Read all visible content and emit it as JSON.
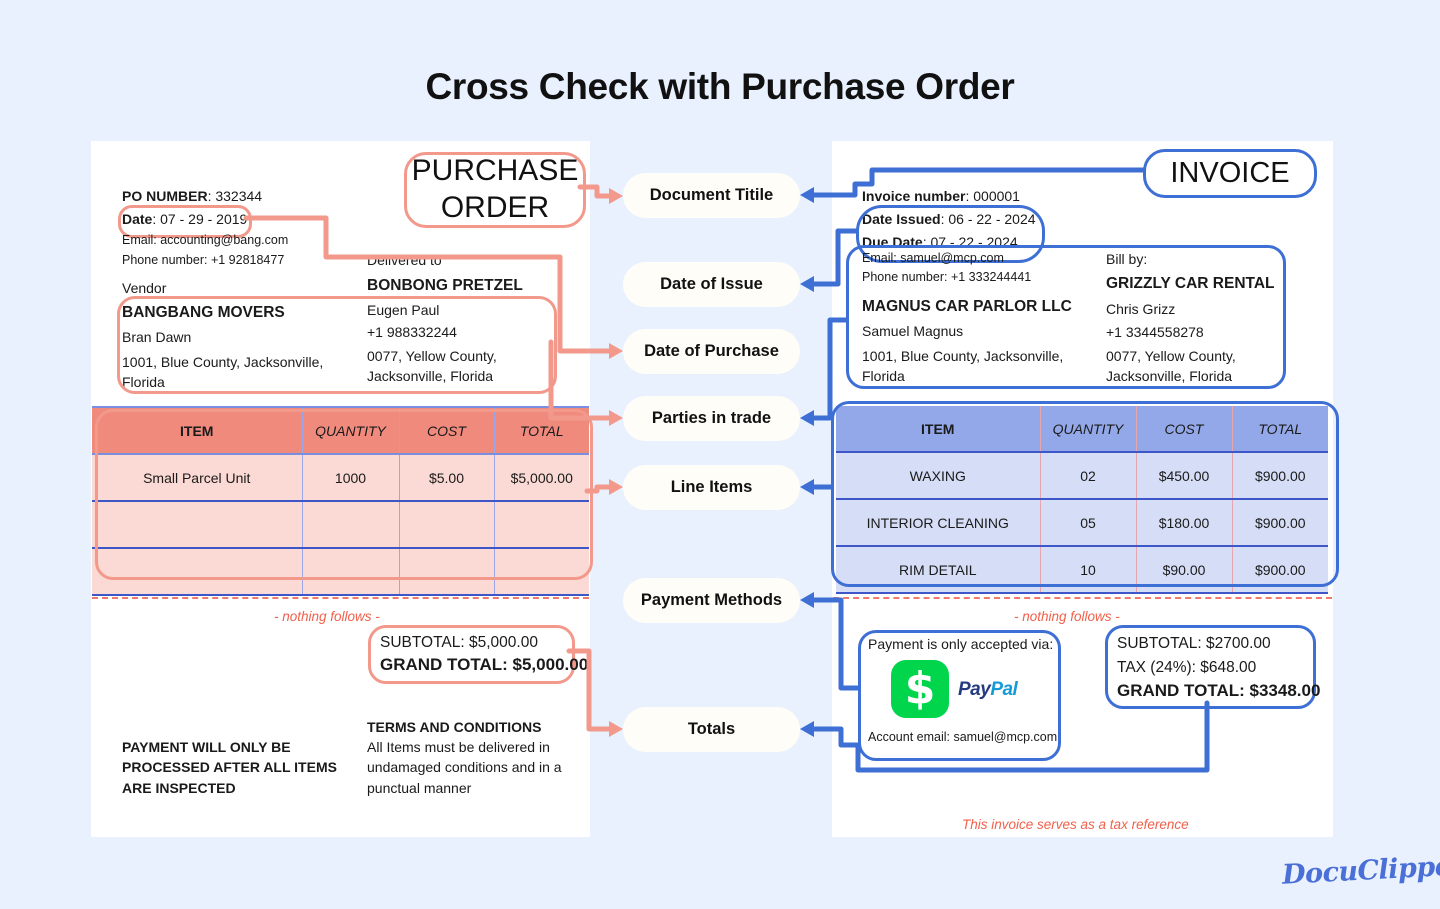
{
  "page": {
    "title": "Cross Check with Purchase Order",
    "background_color": "#e9f0fe",
    "brand_logo": "DocuClipper",
    "accent_pink": "#f2998c",
    "accent_blue": "#3e6fd4"
  },
  "labels": [
    {
      "text": "Document Titile"
    },
    {
      "text": "Date of Issue"
    },
    {
      "text": "Date of Purchase"
    },
    {
      "text": "Parties in trade"
    },
    {
      "text": "Line Items"
    },
    {
      "text": "Payment Methods"
    },
    {
      "text": "Totals"
    }
  ],
  "purchase_order": {
    "doc_type": "PURCHASE ORDER",
    "po_number_label": "PO NUMBER",
    "po_number_value": ": 332344",
    "date_label": "Date",
    "date_value": ": 07 - 29 - 2019",
    "email": "Email: accounting@bang.com",
    "phone": "Phone number: +1 92818477",
    "vendor_caption": "Vendor",
    "vendor_name": "BANGBANG MOVERS",
    "vendor_contact": "Bran Dawn",
    "vendor_address": "1001, Blue County, Jacksonville, Florida",
    "delivered_caption": "Delivered to",
    "delivered_name": "BONBONG PRETZEL",
    "delivered_contact": "Eugen Paul",
    "delivered_phone": "+1 988332244",
    "delivered_address": "0077, Yellow County, Jacksonville, Florida",
    "table": {
      "columns": [
        "ITEM",
        "QUANTITY",
        "COST",
        "TOTAL"
      ],
      "rows": [
        [
          "Small Parcel Unit",
          "1000",
          "$5.00",
          "$5,000.00"
        ],
        [
          "",
          "",
          "",
          ""
        ],
        [
          "",
          "",
          "",
          ""
        ]
      ]
    },
    "nothing_follows": "- nothing follows -",
    "subtotal": "SUBTOTAL: $5,000.00",
    "grand_total": "GRAND TOTAL: $5,000.00",
    "payment_note": "PAYMENT WILL ONLY BE PROCESSED AFTER ALL ITEMS ARE INSPECTED",
    "terms_heading": "TERMS AND CONDITIONS",
    "terms_body": "All Items must be delivered in undamaged conditions and in a punctual manner"
  },
  "invoice": {
    "doc_type": "INVOICE",
    "invoice_number_label": "Invoice number",
    "invoice_number_value": ": 000001",
    "date_issued_label": "Date Issued",
    "date_issued_value": ": 06 - 22 - 2024",
    "due_date_label": "Due Date",
    "due_date_value": ": 07 - 22 - 2024",
    "email": "Email: samuel@mcp.com",
    "phone": "Phone number: +1 333244441",
    "seller_name": "MAGNUS CAR PARLOR LLC",
    "seller_contact": "Samuel Magnus",
    "seller_address": "1001, Blue County, Jacksonville, Florida",
    "bill_by_caption": "Bill by:",
    "buyer_name": "GRIZZLY CAR RENTAL",
    "buyer_contact": "Chris Grizz",
    "buyer_phone": "+1 3344558278",
    "buyer_address": "0077, Yellow County, Jacksonville, Florida",
    "table": {
      "columns": [
        "ITEM",
        "QUANTITY",
        "COST",
        "TOTAL"
      ],
      "rows": [
        [
          "WAXING",
          "02",
          "$450.00",
          "$900.00"
        ],
        [
          "INTERIOR CLEANING",
          "05",
          "$180.00",
          "$900.00"
        ],
        [
          "RIM DETAIL",
          "10",
          "$90.00",
          "$900.00"
        ]
      ]
    },
    "nothing_follows": "- nothing follows -",
    "payment_caption": "Payment is only accepted via:",
    "payment_brand_cashapp": "$",
    "payment_brand_paypal_1": "Pay",
    "payment_brand_paypal_2": "Pal",
    "account_email": "Account email: samuel@mcp.com",
    "subtotal": "SUBTOTAL: $2700.00",
    "tax": "TAX (24%): $648.00",
    "grand_total": "GRAND TOTAL: $3348.00",
    "tax_reference": "This invoice serves as a tax reference"
  }
}
